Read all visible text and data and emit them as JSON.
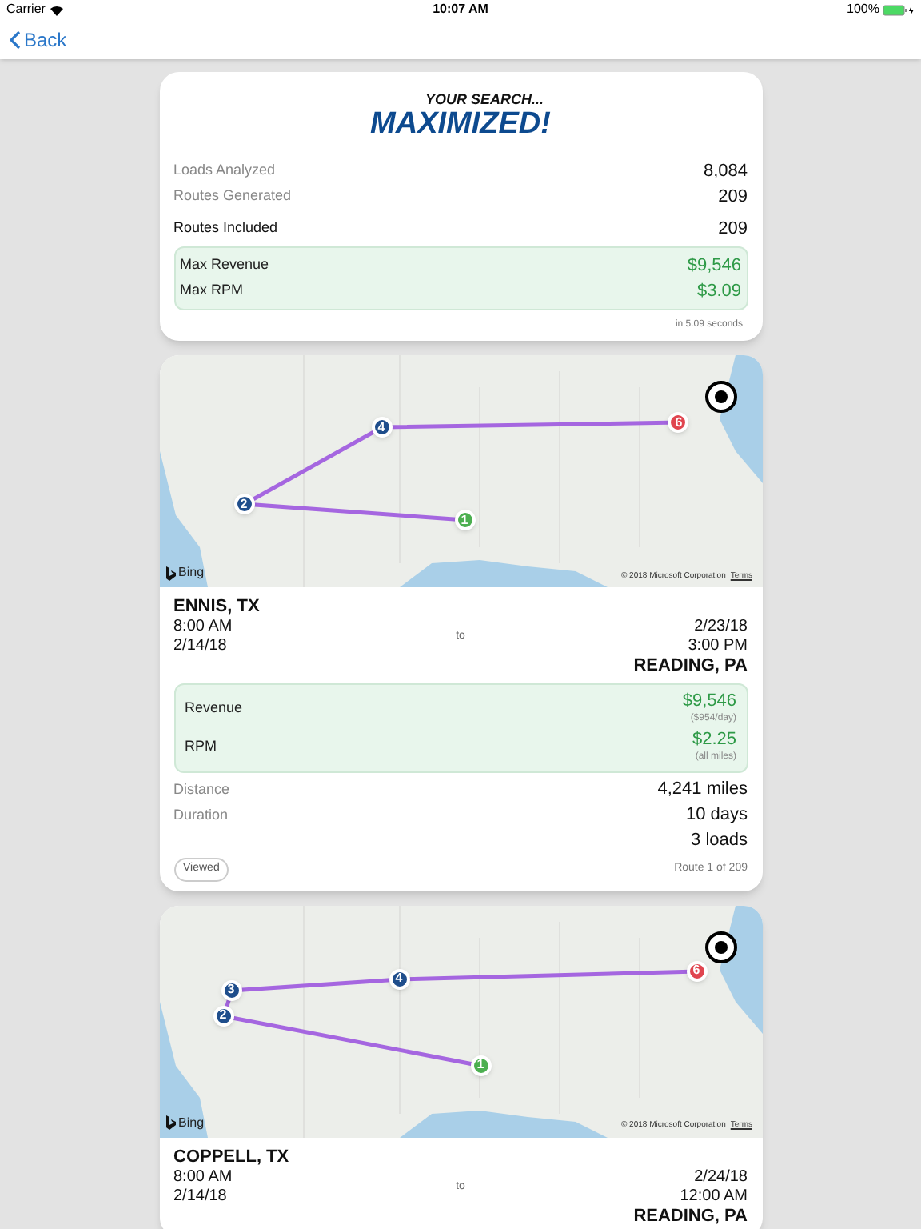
{
  "status_bar": {
    "carrier": "Carrier",
    "time": "10:07 AM",
    "battery": "100%"
  },
  "nav": {
    "back": "Back"
  },
  "summary": {
    "tagline": "YOUR SEARCH...",
    "headline": "MAXIMIZED!",
    "stats": [
      {
        "label": "Loads Analyzed",
        "value": "8,084",
        "kind": "muted"
      },
      {
        "label": "Routes Generated",
        "value": "209",
        "kind": "muted"
      },
      {
        "label": "Routes Included",
        "value": "209",
        "kind": "strong"
      }
    ],
    "highlights": [
      {
        "label": "Max Revenue",
        "value": "$9,546"
      },
      {
        "label": "Max RPM",
        "value": "$3.09"
      }
    ],
    "elapsed": "in 5.09 seconds"
  },
  "routes": [
    {
      "map": {
        "markers": [
          {
            "label": "1",
            "color": "#4caf50"
          },
          {
            "label": "2",
            "color": "#1f4e8c"
          },
          {
            "label": "4",
            "color": "#1f4e8c"
          },
          {
            "label": "6",
            "color": "#e0454f"
          }
        ],
        "attribution": "Bing",
        "copyright": "© 2018 Microsoft Corporation",
        "terms": "Terms"
      },
      "origin": {
        "city": "ENNIS, TX",
        "time": "8:00 AM",
        "date": "2/14/18"
      },
      "connector": "to",
      "destination": {
        "date": "2/23/18",
        "time": "3:00 PM",
        "city": "READING, PA"
      },
      "metrics": [
        {
          "label": "Revenue",
          "value": "$9,546",
          "note": "($954/day)"
        },
        {
          "label": "RPM",
          "value": "$2.25",
          "note": "(all miles)"
        }
      ],
      "details": [
        {
          "label": "Distance",
          "value": "4,241 miles"
        },
        {
          "label": "Duration",
          "value": "10 days"
        },
        {
          "value": "3 loads"
        }
      ],
      "viewed": "Viewed",
      "counter": "Route 1 of 209"
    },
    {
      "map": {
        "markers": [
          {
            "label": "1",
            "color": "#4caf50"
          },
          {
            "label": "2",
            "color": "#1f4e8c"
          },
          {
            "label": "3",
            "color": "#1f4e8c"
          },
          {
            "label": "4",
            "color": "#1f4e8c"
          },
          {
            "label": "6",
            "color": "#e0454f"
          }
        ],
        "attribution": "Bing",
        "copyright": "© 2018 Microsoft Corporation",
        "terms": "Terms"
      },
      "origin": {
        "city": "COPPELL, TX",
        "time": "8:00 AM",
        "date": "2/14/18"
      },
      "connector": "to",
      "destination": {
        "date": "2/24/18",
        "time": "12:00 AM",
        "city": "READING, PA"
      }
    }
  ]
}
